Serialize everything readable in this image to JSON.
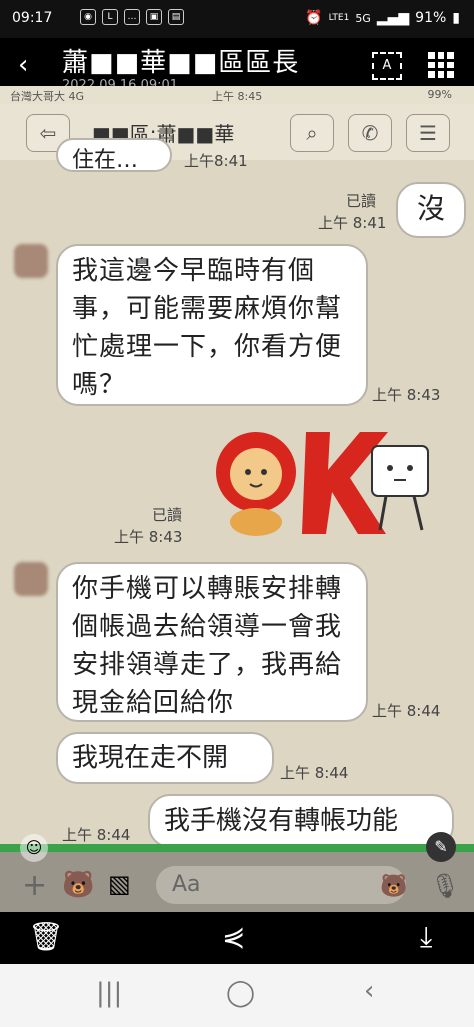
{
  "statusbar": {
    "time": "09:17",
    "battery": "91%",
    "net": "5G",
    "lte": "LTE1"
  },
  "viewer": {
    "title": "蕭■■華■■區區長",
    "date": "2022.09.16 09:01",
    "ocr_label": "A"
  },
  "inner": {
    "carrier": "台灣大哥大 4G",
    "time": "上午 8:45",
    "battery": "99%",
    "contact": "■■區:蕭■■華"
  },
  "messages": {
    "m0": {
      "text": "住在…嗎",
      "time": "上午8:41"
    },
    "m1": {
      "text": "沒",
      "read": "已讀",
      "time": "上午 8:41"
    },
    "m2": {
      "text": "我這邊今早臨時有個事，可能需要麻煩你幫忙處理一下，你看方便嗎？",
      "time": "上午 8:43"
    },
    "m3": {
      "read": "已讀",
      "time": "上午 8:43"
    },
    "m4": {
      "text": "你手機可以轉賬安排轉個帳過去給領導一會我安排領導走了，我再給現金給回給你",
      "time": "上午 8:44"
    },
    "m5": {
      "text": "我現在走不開",
      "time": "上午 8:44"
    },
    "m6": {
      "text": "我手機沒有轉帳功能",
      "time": "上午 8:44"
    }
  },
  "input": {
    "placeholder": "Aa"
  },
  "colors": {
    "chat_bg": "#dcd6c3",
    "sticker_red": "#d7261e",
    "input_green": "#3aa34a"
  }
}
